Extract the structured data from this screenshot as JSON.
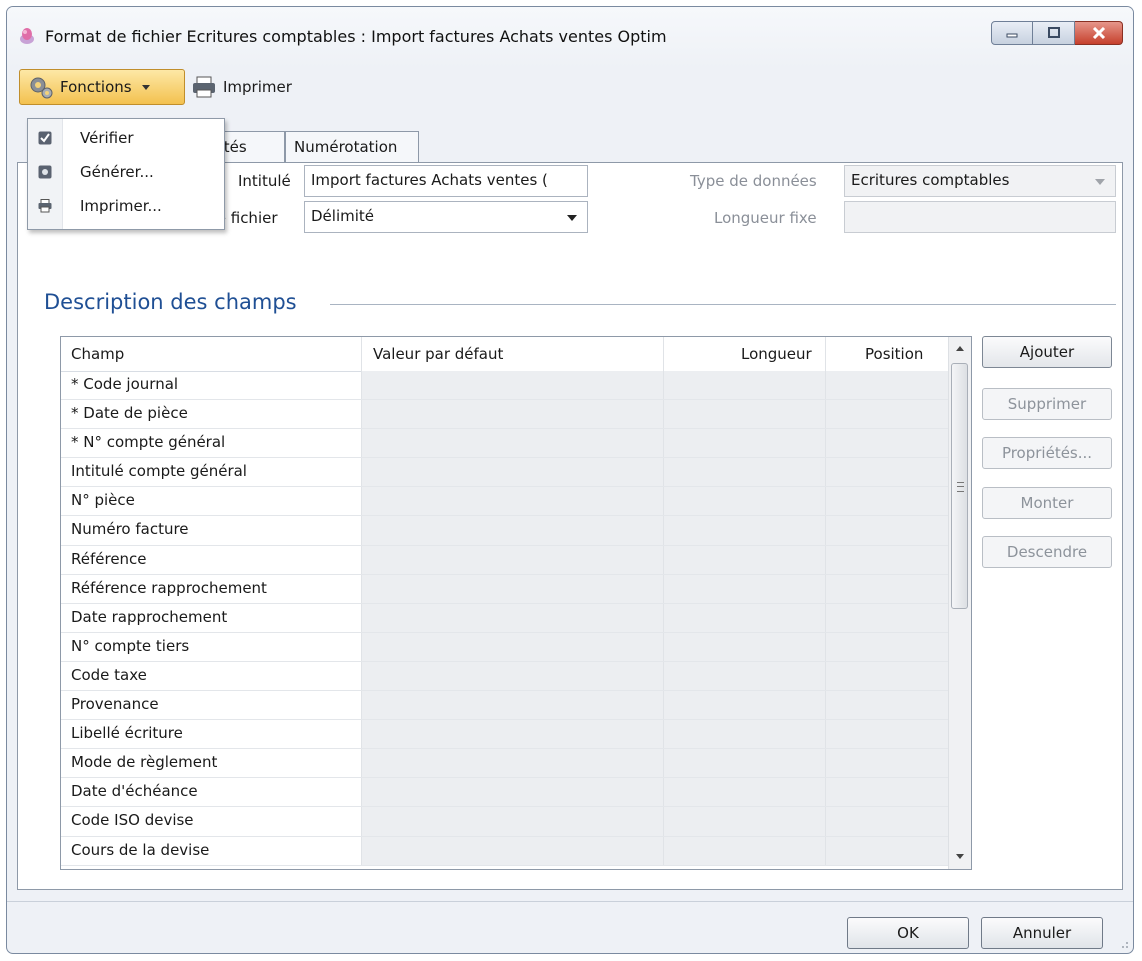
{
  "window": {
    "title": "Format de fichier Ecritures comptables : Import factures Achats ventes Optim"
  },
  "toolbar": {
    "fonctions_label": "Fonctions",
    "imprimer_label": "Imprimer"
  },
  "menu": {
    "items": [
      {
        "label": "Vérifier",
        "icon": "check-icon"
      },
      {
        "label": "Générer...",
        "icon": "generate-icon"
      },
      {
        "label": "Imprimer...",
        "icon": "printer-icon"
      }
    ]
  },
  "tabs": [
    {
      "label": "laritités"
    },
    {
      "label": "Numérotation"
    }
  ],
  "form": {
    "intitule_label": "Intitulé",
    "intitule_value": "Import factures Achats ventes (",
    "type_fichier_label": "Type de fichier",
    "type_fichier_value": "Délimité",
    "type_donnees_label": "Type de données",
    "type_donnees_value": "Ecritures comptables",
    "longueur_fixe_label": "Longueur fixe",
    "longueur_fixe_value": ""
  },
  "section": {
    "title": "Description des champs"
  },
  "table": {
    "columns": [
      "Champ",
      "Valeur par défaut",
      "Longueur",
      "Position"
    ],
    "rows": [
      "* Code journal",
      "* Date de pièce",
      "* N° compte général",
      "Intitulé compte général",
      "N° pièce",
      "Numéro facture",
      "Référence",
      "Référence rapprochement",
      "Date rapprochement",
      "N° compte tiers",
      "Code taxe",
      "Provenance",
      "Libellé écriture",
      "Mode de règlement",
      "Date d'échéance",
      "Code ISO devise",
      "Cours de la devise"
    ]
  },
  "side_buttons": {
    "ajouter": "Ajouter",
    "supprimer": "Supprimer",
    "proprietes": "Propriétés...",
    "monter": "Monter",
    "descendre": "Descendre"
  },
  "footer": {
    "ok": "OK",
    "annuler": "Annuler"
  },
  "colors": {
    "section_title": "#1f4f94",
    "fonctions_button": "#f3c14f",
    "close_button": "#c6402d"
  }
}
